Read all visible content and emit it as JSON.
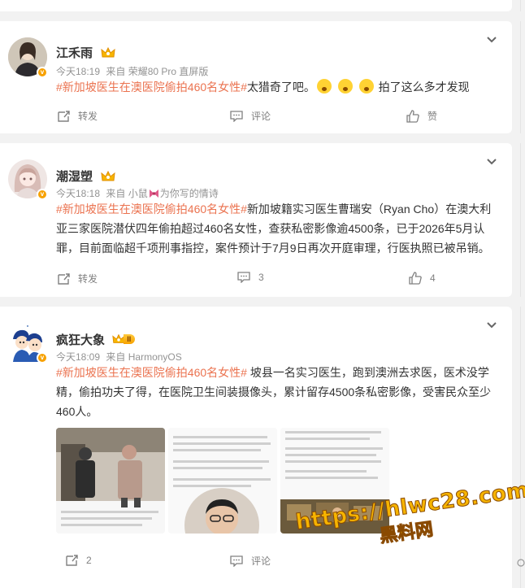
{
  "posts": [
    {
      "username": "江禾雨",
      "time": "今天18:19",
      "source_prefix": "来自",
      "source": "荣耀80 Pro 直屏版",
      "topic": "#新加坡医生在澳医院偷拍460名女性#",
      "text_a": "太猎奇了吧。",
      "text_b": "拍了这么多才发现",
      "emojis": [
        "surprised-emoji",
        "surprised-emoji",
        "surprised-emoji"
      ],
      "repost_label": "转发",
      "comment_label": "评论",
      "like_label": "赞"
    },
    {
      "username": "潮湿塑",
      "time": "今天18:18",
      "source_prefix": "来自",
      "source": "小鼠",
      "source_suffix": "为你写的情诗",
      "topic": "#新加坡医生在澳医院偷拍460名女性#",
      "line1_rest": "新加坡籍实习医生曹瑞安（Ryan Cho）在澳大利",
      "line2": "亚三家医院潜伏四年偷拍超过460名女性，查获私密影像逾4500条，已于2026年5月认",
      "line3": "罪，目前面临超千项刑事指控，案件预计于7月9日再次开庭审理，行医执照已被吊销。",
      "repost_label": "转发",
      "comment_count": "3",
      "like_count": "4"
    },
    {
      "username": "疯狂大象",
      "badge_text": "II",
      "time": "今天18:09",
      "source_prefix": "来自",
      "source": "HarmonyOS",
      "topic": "#新加坡医生在澳医院偷拍460名女性#",
      "line1_rest": " 坡县一名实习医生，跑到澳洲去求医，医术没学",
      "line2": "精，偷拍功夫了得，在医院卫生间装摄像头，累计留存4500条私密影像，受害民众至少",
      "line3": "460人。",
      "repost_count": "2",
      "comment_label": "评论"
    }
  ],
  "watermark": {
    "url": "https://hlwc28.com",
    "name": "黑料网"
  }
}
